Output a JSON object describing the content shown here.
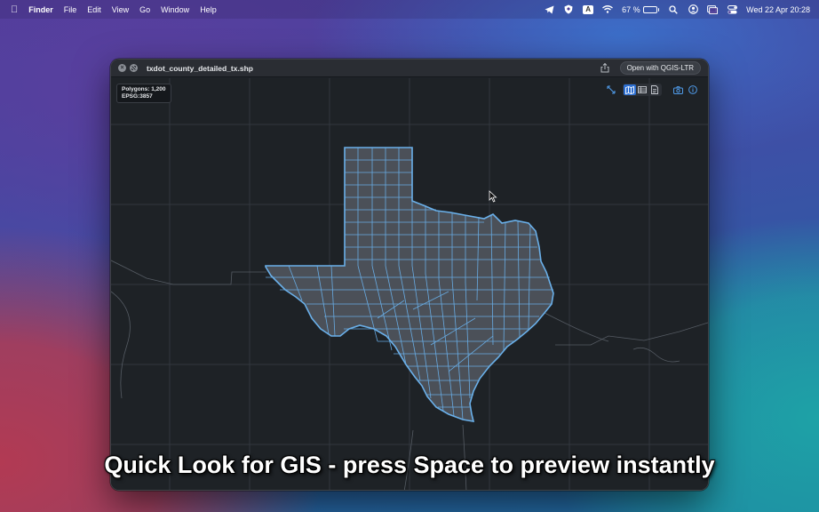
{
  "menubar": {
    "app_name": "Finder",
    "menus": [
      "File",
      "Edit",
      "View",
      "Go",
      "Window",
      "Help"
    ],
    "keyboard_badge": "A",
    "battery_percent": "67 %",
    "battery_level": 0.67,
    "datetime": "Wed 22 Apr  20:28"
  },
  "window": {
    "title": "txdot_county_detailed_tx.shp",
    "open_button": "Open with QGIS-LTR",
    "info": {
      "polygons": "Polygons: 1,200",
      "epsg": "EPSG:3857"
    },
    "view_mode_selected": "map"
  },
  "caption": "Quick Look for GIS - press Space to preview instantly",
  "colors": {
    "map_background": "#1e2226",
    "county_fill": "#4b5058",
    "county_stroke": "#6ab0ea",
    "grid": "#32373e",
    "accent": "#2d6fd1"
  }
}
